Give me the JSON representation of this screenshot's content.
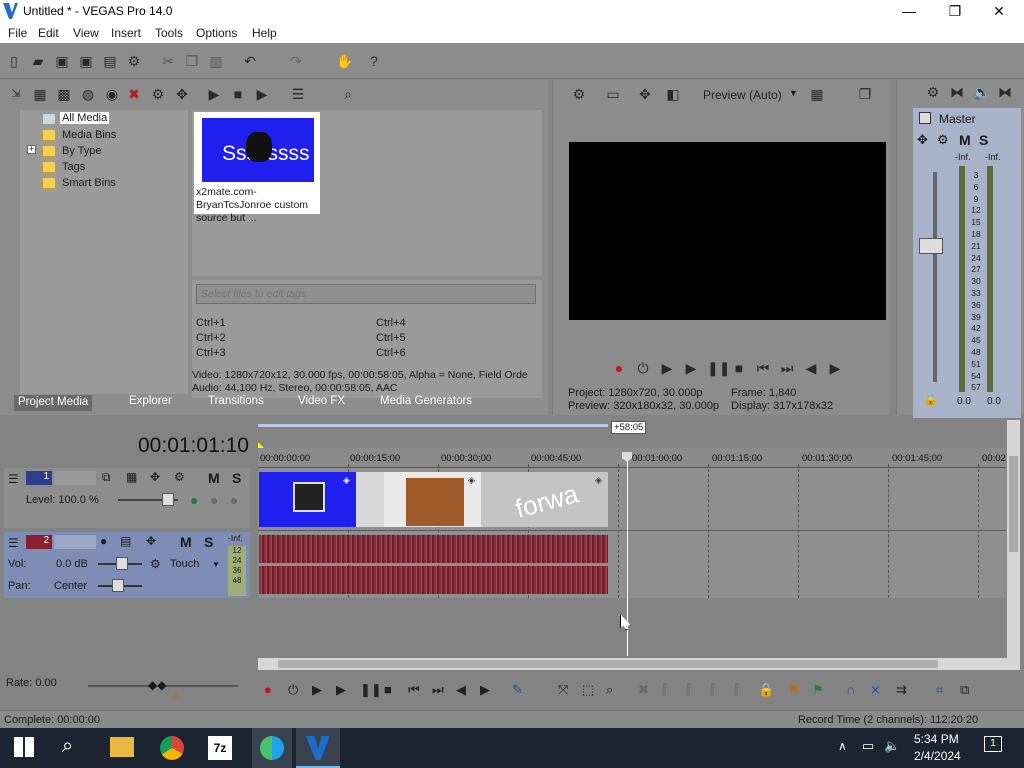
{
  "window": {
    "title": "Untitled * - VEGAS Pro 14.0",
    "minimize": "—",
    "maximize": "❐",
    "close": "✕"
  },
  "menu": [
    "File",
    "Edit",
    "View",
    "Insert",
    "Tools",
    "Options",
    "Help"
  ],
  "media": {
    "tree": [
      "All Media",
      "Media Bins",
      "By Type",
      "Tags",
      "Smart Bins"
    ],
    "expander": "+",
    "thumb_text": "Ssssssss",
    "thumb_caption": "x2mate.com-BryanTcsJonroe custom source but ...",
    "tags_placeholder": "Select files to edit tags",
    "shortcuts": [
      "Ctrl+1",
      "Ctrl+2",
      "Ctrl+3",
      "Ctrl+4",
      "Ctrl+5",
      "Ctrl+6"
    ],
    "info_video": "Video: 1280x720x12, 30.000 fps, 00:00:58:05, Alpha = None, Field Orde",
    "info_audio": "Audio: 44,100 Hz, Stereo, 00:00:58:05, AAC"
  },
  "tabs": [
    "Project Media",
    "Explorer",
    "Transitions",
    "Video FX",
    "Media Generators"
  ],
  "preview": {
    "mode": "Preview (Auto)",
    "project": "Project:  1280x720, 30.000p",
    "frame": "Frame:   1,840",
    "preview": "Preview:  320x180x32, 30.000p",
    "display": "Display:  317x178x32"
  },
  "master": {
    "title": "Master",
    "m": "M",
    "s": "S",
    "inf_l": "-Inf.",
    "inf_r": "-Inf.",
    "val_l": "0.0",
    "val_r": "0.0",
    "scale": [
      "3",
      "6",
      "9",
      "12",
      "15",
      "18",
      "21",
      "24",
      "27",
      "30",
      "33",
      "36",
      "39",
      "42",
      "45",
      "48",
      "51",
      "54",
      "57"
    ]
  },
  "timeline": {
    "timecode": "00:01:01:10",
    "length_badge": "+58:05",
    "ruler": [
      "00:00:00;00",
      "00:00:15;00",
      "00:00:30;00",
      "00:00:45;00",
      "00:01:00;00",
      "00:01:15;00",
      "00:01:30;00",
      "00:01:45;00",
      "00:02"
    ],
    "video_track": {
      "num": "1",
      "m": "M",
      "s": "S",
      "level": "Level: 100.0 %"
    },
    "audio_track": {
      "num": "2",
      "m": "M",
      "s": "S",
      "vol_label": "Vol:",
      "vol": "0.0 dB",
      "pan_label": "Pan:",
      "pan": "Center",
      "touch": "Touch",
      "inf": "-Inf.",
      "scale": [
        "12",
        "24",
        "36",
        "48"
      ]
    },
    "clip_text": "forwa"
  },
  "rate": "Rate: 0.00",
  "status": {
    "left": "Complete: 00:00:00",
    "right": "Record Time (2 channels): 112:20:20"
  },
  "taskbar": {
    "time": "5:34 PM",
    "date": "2/4/2024",
    "notif": "1",
    "app_7z": "7z"
  },
  "colors": {
    "accent": "#1e6ec9",
    "track_header": "#7d8db5",
    "clip_blue": "#1f1ff0",
    "audio_wave": "#8c2e3c"
  }
}
